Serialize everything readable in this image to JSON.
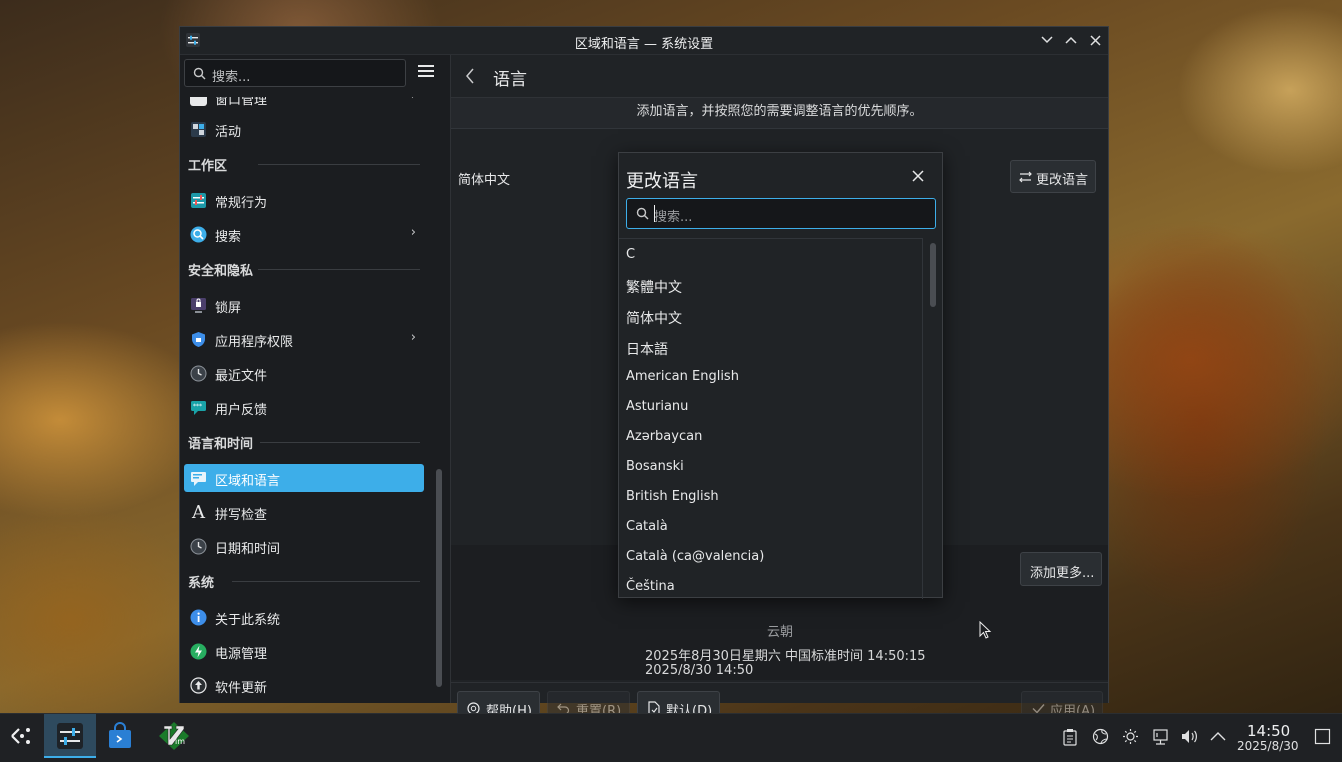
{
  "window": {
    "title": "区域和语言 — 系统设置",
    "min_glyph": "⌄",
    "max_glyph": "⌃",
    "close_glyph": "✕"
  },
  "sidebar": {
    "search_placeholder": "搜索...",
    "partial_item": "窗口管理",
    "items": [
      {
        "label": "活动",
        "icon": "activities-icon"
      },
      {
        "section": "工作区"
      },
      {
        "label": "常规行为",
        "icon": "general-behavior-icon"
      },
      {
        "label": "搜索",
        "icon": "search-icon",
        "chevron": true
      },
      {
        "section": "安全和隐私"
      },
      {
        "label": "锁屏",
        "icon": "lock-screen-icon"
      },
      {
        "label": "应用程序权限",
        "icon": "shield-icon",
        "chevron": true
      },
      {
        "label": "最近文件",
        "icon": "clock-icon"
      },
      {
        "label": "用户反馈",
        "icon": "feedback-icon"
      },
      {
        "section": "语言和时间"
      },
      {
        "label": "区域和语言",
        "icon": "region-language-icon",
        "active": true
      },
      {
        "label": "拼写检查",
        "icon": "spellcheck-icon"
      },
      {
        "label": "日期和时间",
        "icon": "clock-icon"
      },
      {
        "section": "系统"
      },
      {
        "label": "关于此系统",
        "icon": "info-icon"
      },
      {
        "label": "电源管理",
        "icon": "power-icon"
      },
      {
        "label": "软件更新",
        "icon": "update-icon"
      }
    ],
    "labels": {
      "activities": "活动",
      "workspace": "工作区",
      "general_behavior": "常规行为",
      "search": "搜索",
      "security_privacy": "安全和隐私",
      "lock_screen": "锁屏",
      "app_permissions": "应用程序权限",
      "recent_files": "最近文件",
      "user_feedback": "用户反馈",
      "language_time": "语言和时间",
      "region_language": "区域和语言",
      "spellcheck": "拼写检查",
      "date_time": "日期和时间",
      "system": "系统",
      "about_system": "关于此系统",
      "power_management": "电源管理",
      "software_update": "软件更新"
    }
  },
  "main": {
    "title": "语言",
    "info": "添加语言，并按照您的需要调整语言的优先顺序。",
    "current_language": "简体中文",
    "change_language_button": "更改语言",
    "add_more_button": "添加更多...",
    "date_label": "云朝",
    "date_long": "2025年8月30日星期六 中国标准时间 14:50:15",
    "date_short": "2025/8/30 14:50"
  },
  "footer": {
    "help": "帮助(H)",
    "reset": "重置(R)",
    "defaults": "默认(D)",
    "apply": "应用(A)"
  },
  "dialog": {
    "title": "更改语言",
    "search_placeholder": "搜索...",
    "languages": [
      "C",
      "繁體中文",
      "简体中文",
      "日本語",
      "American English",
      "Asturianu",
      "Azərbaycan",
      "Bosanski",
      "British English",
      "Català",
      "Català (ca@valencia)",
      "Čeština"
    ]
  },
  "taskbar": {
    "clock_time": "14:50",
    "clock_date": "2025/8/30"
  },
  "colors": {
    "accent": "#3daee9",
    "window_bg": "#202326",
    "sidebar_bg": "#1b1d20"
  }
}
